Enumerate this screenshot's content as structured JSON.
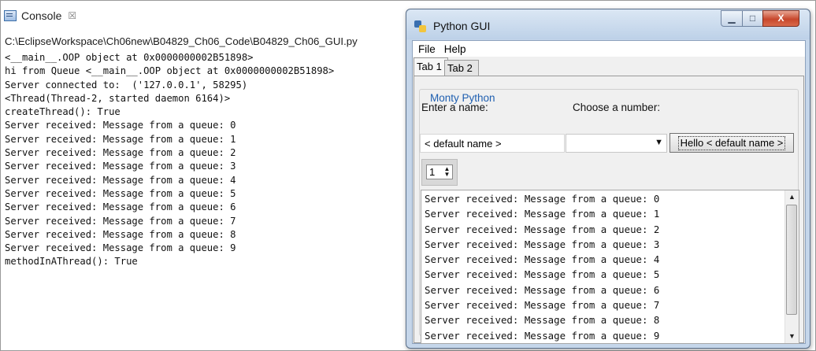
{
  "console": {
    "tab_label": "Console",
    "close_glyph": "☒",
    "path": "C:\\EclipseWorkspace\\Ch06new\\B04829_Ch06_Code\\B04829_Ch06_GUI.py",
    "output": "<__main__.OOP object at 0x0000000002B51898>\nhi from Queue <__main__.OOP object at 0x0000000002B51898>\nServer connected to:  ('127.0.0.1', 58295)\n<Thread(Thread-2, started daemon 6164)>\ncreateThread(): True\nServer received: Message from a queue: 0\nServer received: Message from a queue: 1\nServer received: Message from a queue: 2\nServer received: Message from a queue: 3\nServer received: Message from a queue: 4\nServer received: Message from a queue: 5\nServer received: Message from a queue: 6\nServer received: Message from a queue: 7\nServer received: Message from a queue: 8\nServer received: Message from a queue: 9\nmethodInAThread(): True"
  },
  "window": {
    "title": "Python GUI",
    "minimize_glyph": "▁",
    "maximize_glyph": "□",
    "close_glyph": "X",
    "menu": {
      "file": "File",
      "help": "Help"
    },
    "tabs": [
      "Tab 1",
      "Tab 2"
    ],
    "group_title": "Monty Python",
    "name_label": "Enter a name:",
    "number_label": "Choose a number:",
    "name_value": "< default name >",
    "combo_value": "",
    "combo_arrow": "▼",
    "button_label": "Hello < default name >",
    "spin_value": "1",
    "spin_arrows": "▲\n▼",
    "scroll_text": "Server received: Message from a queue: 0\nServer received: Message from a queue: 1\nServer received: Message from a queue: 2\nServer received: Message from a queue: 3\nServer received: Message from a queue: 4\nServer received: Message from a queue: 5\nServer received: Message from a queue: 6\nServer received: Message from a queue: 7\nServer received: Message from a queue: 8\nServer received: Message from a queue: 9",
    "scroll_up": "▲",
    "scroll_down": "▼"
  },
  "icons": {
    "console": "console-icon",
    "app": "python-gui-icon"
  }
}
